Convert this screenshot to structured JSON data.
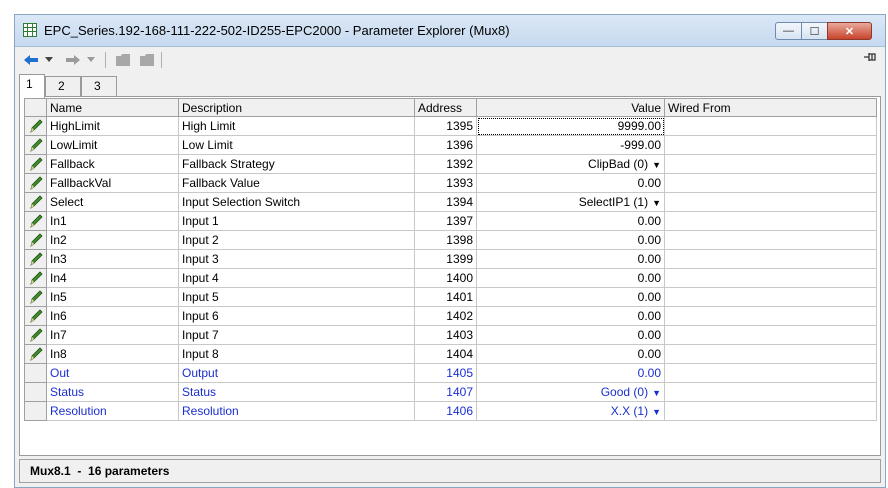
{
  "window": {
    "title": "EPC_Series.192-168-111-222-502-ID255-EPC2000 - Parameter Explorer (Mux8)",
    "controls": {
      "minimize": "—",
      "maximize": "☐",
      "close": "✕"
    }
  },
  "toolbar": {
    "back_icon": "back-arrow-icon",
    "forward_icon": "forward-arrow-icon",
    "pin_icon": "pin-icon"
  },
  "tabs": [
    {
      "label": "1"
    },
    {
      "label": "2"
    },
    {
      "label": "3"
    }
  ],
  "table": {
    "columns": [
      "Name",
      "Description",
      "Address",
      "Value",
      "Wired From"
    ],
    "rows": [
      {
        "name": "HighLimit",
        "description": "High Limit",
        "address": "1395",
        "value": "9999.00",
        "wired_from": ""
      },
      {
        "name": "LowLimit",
        "description": "Low Limit",
        "address": "1396",
        "value": "-999.00",
        "wired_from": ""
      },
      {
        "name": "Fallback",
        "description": "Fallback Strategy",
        "address": "1392",
        "value": "ClipBad (0)",
        "wired_from": ""
      },
      {
        "name": "FallbackVal",
        "description": "Fallback Value",
        "address": "1393",
        "value": "0.00",
        "wired_from": ""
      },
      {
        "name": "Select",
        "description": "Input Selection Switch",
        "address": "1394",
        "value": "SelectIP1 (1)",
        "wired_from": ""
      },
      {
        "name": "In1",
        "description": "Input 1",
        "address": "1397",
        "value": "0.00",
        "wired_from": ""
      },
      {
        "name": "In2",
        "description": "Input 2",
        "address": "1398",
        "value": "0.00",
        "wired_from": ""
      },
      {
        "name": "In3",
        "description": "Input 3",
        "address": "1399",
        "value": "0.00",
        "wired_from": ""
      },
      {
        "name": "In4",
        "description": "Input 4",
        "address": "1400",
        "value": "0.00",
        "wired_from": ""
      },
      {
        "name": "In5",
        "description": "Input 5",
        "address": "1401",
        "value": "0.00",
        "wired_from": ""
      },
      {
        "name": "In6",
        "description": "Input 6",
        "address": "1402",
        "value": "0.00",
        "wired_from": ""
      },
      {
        "name": "In7",
        "description": "Input 7",
        "address": "1403",
        "value": "0.00",
        "wired_from": ""
      },
      {
        "name": "In8",
        "description": "Input 8",
        "address": "1404",
        "value": "0.00",
        "wired_from": ""
      },
      {
        "name": "Out",
        "description": "Output",
        "address": "1405",
        "value": "0.00",
        "wired_from": ""
      },
      {
        "name": "Status",
        "description": "Status",
        "address": "1407",
        "value": "Good (0)",
        "wired_from": ""
      },
      {
        "name": "Resolution",
        "description": "Resolution",
        "address": "1406",
        "value": "X.X (1)",
        "wired_from": ""
      }
    ]
  },
  "status_bar": {
    "text": "Mux8.1  -  16 parameters"
  },
  "colors": {
    "read_only_text": "#1a2fd0",
    "pencil_icon": "#2e7d1f"
  }
}
